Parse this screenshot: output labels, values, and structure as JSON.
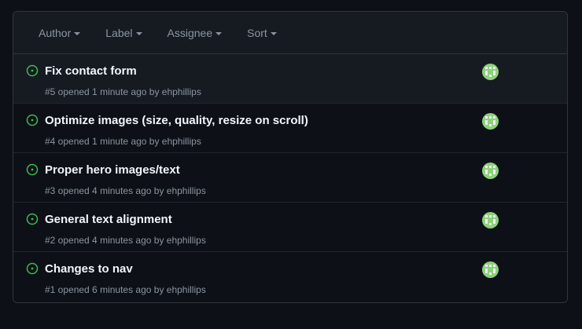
{
  "filters": [
    {
      "label": "Author"
    },
    {
      "label": "Label"
    },
    {
      "label": "Assignee"
    },
    {
      "label": "Sort"
    }
  ],
  "issues": [
    {
      "title": "Fix contact form",
      "meta": "#5 opened 1 minute ago by ehphillips"
    },
    {
      "title": "Optimize images (size, quality, resize on scroll)",
      "meta": "#4 opened 1 minute ago by ehphillips"
    },
    {
      "title": "Proper hero images/text",
      "meta": "#3 opened 4 minutes ago by ehphillips"
    },
    {
      "title": "General text alignment",
      "meta": "#2 opened 4 minutes ago by ehphillips"
    },
    {
      "title": "Changes to nav",
      "meta": "#1 opened 6 minutes ago by ehphillips"
    }
  ],
  "icons": {
    "status": "issue-opened-icon",
    "avatar": "identicon-avatar",
    "caret": "caret-down-icon"
  },
  "colors": {
    "background": "#0d1117",
    "header_background": "#161b22",
    "border": "#30363d",
    "open_green": "#3fb950",
    "avatar_green": "#8ed07c",
    "title": "#f0f6fc",
    "muted": "#8b949e"
  }
}
